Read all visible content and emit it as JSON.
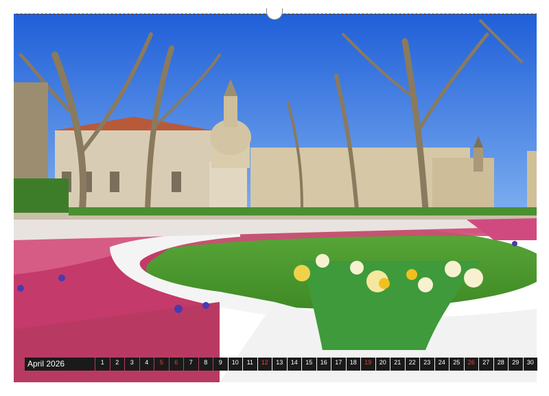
{
  "calendar": {
    "month_label": "April 2026",
    "days": [
      {
        "num": "1",
        "red": false
      },
      {
        "num": "2",
        "red": false
      },
      {
        "num": "3",
        "red": false
      },
      {
        "num": "4",
        "red": false
      },
      {
        "num": "5",
        "red": true
      },
      {
        "num": "6",
        "red": true
      },
      {
        "num": "7",
        "red": false
      },
      {
        "num": "8",
        "red": false
      },
      {
        "num": "9",
        "red": false
      },
      {
        "num": "10",
        "red": false
      },
      {
        "num": "11",
        "red": false
      },
      {
        "num": "12",
        "red": true
      },
      {
        "num": "13",
        "red": false
      },
      {
        "num": "14",
        "red": false
      },
      {
        "num": "15",
        "red": false
      },
      {
        "num": "16",
        "red": false
      },
      {
        "num": "17",
        "red": false
      },
      {
        "num": "18",
        "red": false
      },
      {
        "num": "19",
        "red": true
      },
      {
        "num": "20",
        "red": false
      },
      {
        "num": "21",
        "red": false
      },
      {
        "num": "22",
        "red": false
      },
      {
        "num": "23",
        "red": false
      },
      {
        "num": "24",
        "red": false
      },
      {
        "num": "25",
        "red": false
      },
      {
        "num": "26",
        "red": true
      },
      {
        "num": "27",
        "red": false
      },
      {
        "num": "28",
        "red": false
      },
      {
        "num": "29",
        "red": false
      },
      {
        "num": "30",
        "red": false
      }
    ]
  },
  "colors": {
    "sky": "#2f6fe0",
    "lawn": "#4a9a2a",
    "sandstone": "#d6c7a6",
    "strip": "#1a1a1a",
    "holiday": "#e0483c"
  }
}
